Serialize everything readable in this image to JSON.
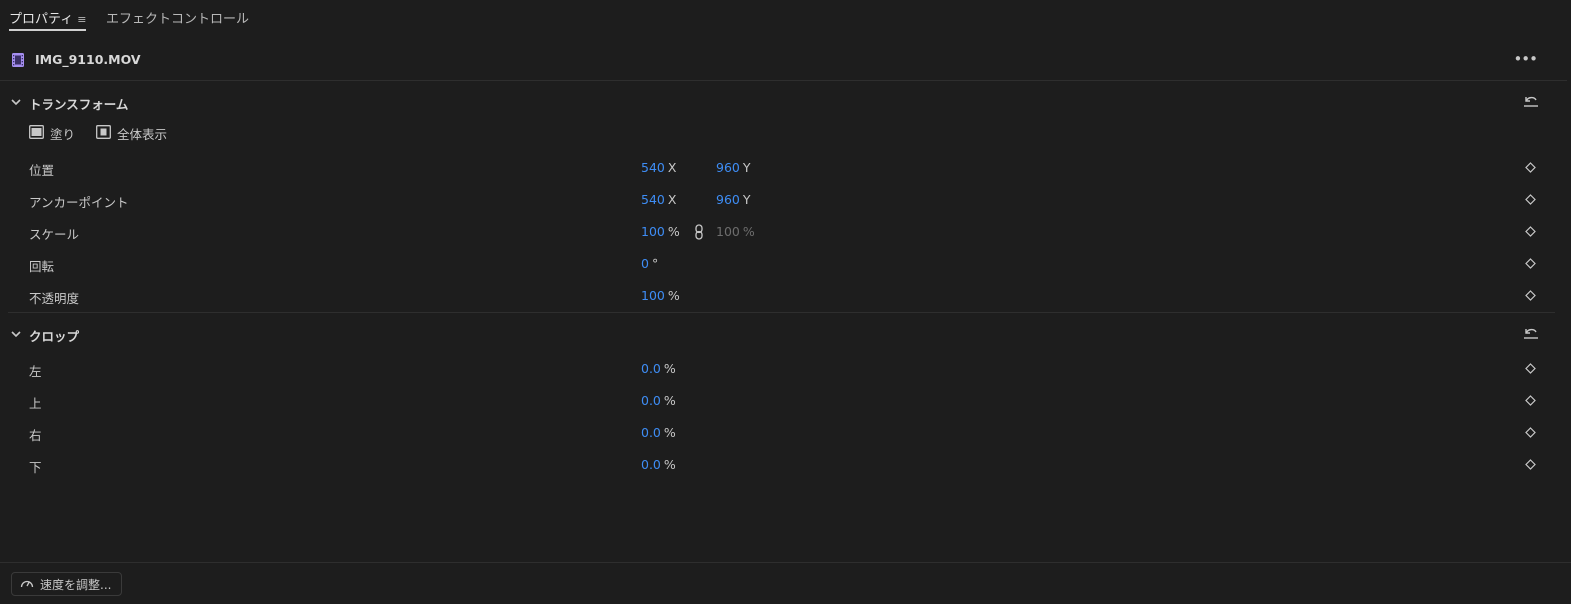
{
  "tabs": [
    {
      "label": "プロパティ",
      "menu": "≡",
      "active": true
    },
    {
      "label": "エフェクトコントロール",
      "active": false
    }
  ],
  "clip": {
    "name": "IMG_9110.MOV",
    "more": "•••"
  },
  "transform": {
    "title": "トランスフォーム",
    "fit": [
      {
        "label": "塗り",
        "icon": "fill-frame-icon"
      },
      {
        "label": "全体表示",
        "icon": "fit-frame-icon"
      }
    ],
    "properties": [
      {
        "label": "位置",
        "v1": "540",
        "u1": "X",
        "v2": "960",
        "u2": "Y"
      },
      {
        "label": "アンカーポイント",
        "v1": "540",
        "u1": "X",
        "v2": "960",
        "u2": "Y"
      },
      {
        "label": "スケール",
        "v1": "100",
        "u1": "%",
        "v2": "100",
        "u2": "%"
      },
      {
        "label": "回転",
        "v1": "0",
        "u1": "°"
      },
      {
        "label": "不透明度",
        "v1": "100",
        "u1": "%"
      }
    ]
  },
  "crop": {
    "title": "クロップ",
    "properties": [
      {
        "label": "左",
        "v1": "0.0",
        "u1": "%"
      },
      {
        "label": "上",
        "v1": "0.0",
        "u1": "%"
      },
      {
        "label": "右",
        "v1": "0.0",
        "u1": "%"
      },
      {
        "label": "下",
        "v1": "0.0",
        "u1": "%"
      }
    ]
  },
  "footer": {
    "speed_label": "速度を調整..."
  },
  "colors": {
    "accent": "#3e8df5",
    "background": "#1d1d1d",
    "clip_icon": "#a58ef0"
  }
}
